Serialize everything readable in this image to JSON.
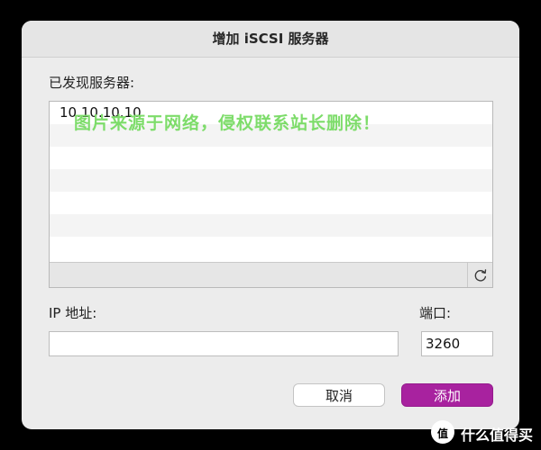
{
  "dialog": {
    "title": "增加 iSCSI 服务器",
    "found_servers_label": "已发现服务器:",
    "servers": [
      "10.10.10.10"
    ],
    "refresh_icon": "refresh-icon",
    "ip_label": "IP 地址:",
    "ip_value": "",
    "port_label": "端口:",
    "port_value": "3260",
    "cancel_label": "取消",
    "add_label": "添加"
  },
  "overlay": {
    "watermark": "图片来源于网络，侵权联系站长删除！",
    "logo_mark": "值",
    "logo_text": "什么值得买"
  },
  "colors": {
    "accent": "#a8229f",
    "watermark": "#7ddc6a",
    "background": "#000000",
    "dialog": "#ececec"
  }
}
